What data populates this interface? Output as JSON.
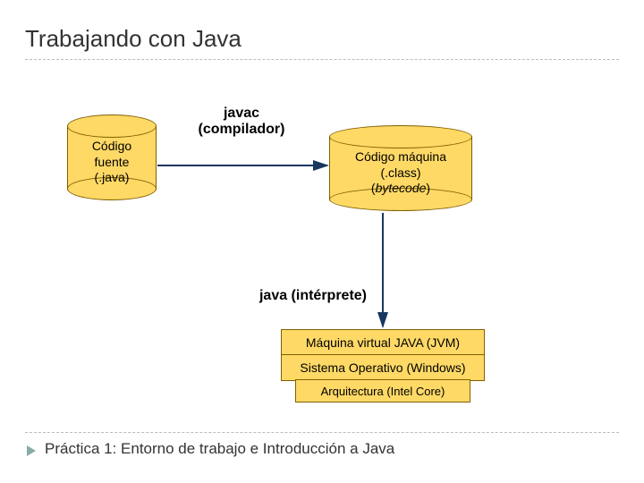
{
  "title": "Trabajando con Java",
  "cylinder_source": {
    "line1": "Código",
    "line2": "fuente",
    "line3": "(.java)"
  },
  "compiler_label": {
    "line1": "javac",
    "line2": "(compilador)"
  },
  "cylinder_bytecode": {
    "line1": "Código máquina",
    "line2": "(.class)",
    "line3_prefix": "(",
    "line3_italic": "bytecode",
    "line3_suffix": ")"
  },
  "interpreter_label": "java (intérprete)",
  "stack": {
    "jvm": "Máquina virtual JAVA (JVM)",
    "os": "Sistema Operativo (Windows)",
    "hw": "Arquitectura (Intel Core)"
  },
  "footer": "Práctica 1: Entorno de trabajo e Introducción a Java"
}
